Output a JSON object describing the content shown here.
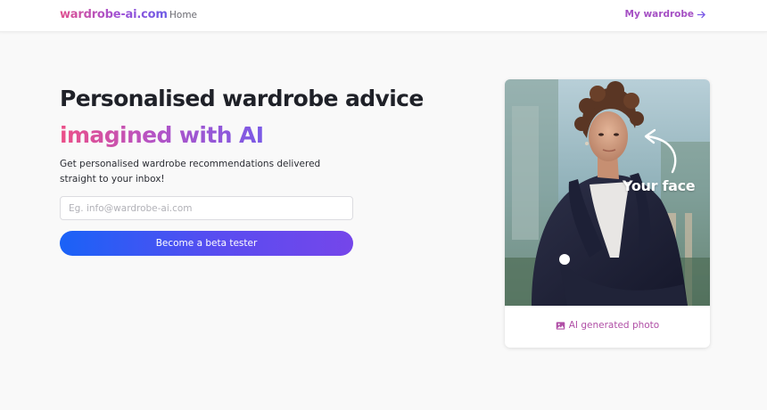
{
  "nav": {
    "brand": "wardrobe-ai.com",
    "home": "Home",
    "my_wardrobe": "My wardrobe"
  },
  "hero": {
    "headline": "Personalised wardrobe advice",
    "highlight": "imagined with AI",
    "subtitle": "Get personalised wardrobe recommendations delivered straight to your inbox!",
    "email_placeholder": "Eg. info@wardrobe-ai.com",
    "cta": "Become a beta tester"
  },
  "card": {
    "face_label": "Your face",
    "caption": "AI generated photo"
  },
  "colors": {
    "brand_pink": "#e0508e",
    "brand_purple": "#a550c4",
    "cta_blue": "#1a62f7",
    "cta_violet": "#7546ea"
  },
  "icons": [
    "arrow-right-icon",
    "image-icon",
    "curved-arrow-icon"
  ]
}
